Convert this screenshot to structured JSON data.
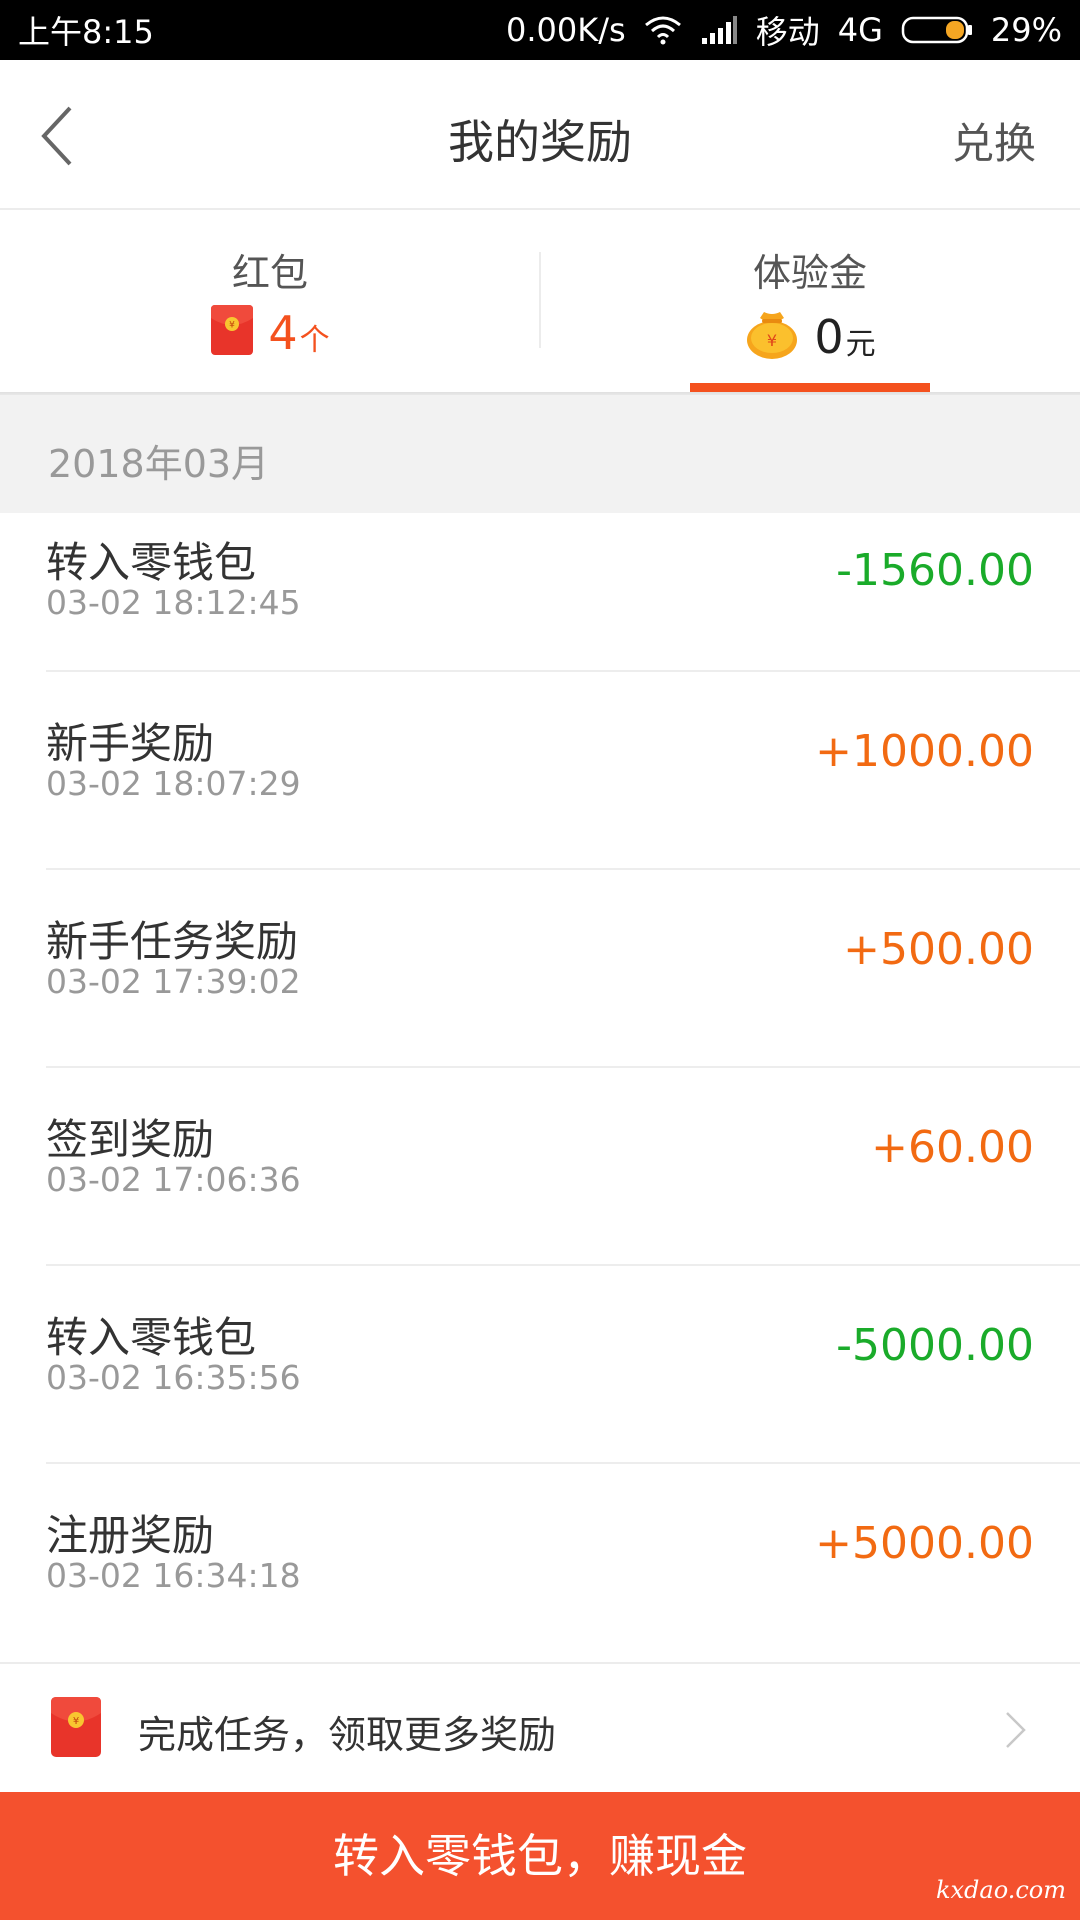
{
  "status_bar": {
    "time": "上午8:15",
    "speed": "0.00K/s",
    "carrier": "移动",
    "network": "4G",
    "battery": "29%"
  },
  "nav": {
    "title": "我的奖励",
    "action": "兑换",
    "back_icon": "chevron-left-icon"
  },
  "tabs": [
    {
      "label": "红包",
      "value": "4",
      "unit": "个",
      "icon": "red-packet-icon",
      "selected": false
    },
    {
      "label": "体验金",
      "value": "0",
      "unit": "元",
      "icon": "money-bag-icon",
      "selected": true
    }
  ],
  "month": "2018年03月",
  "records": [
    {
      "title": "转入零钱包",
      "time": "03-02 18:12:45",
      "amount": "-1560.00",
      "type": "out"
    },
    {
      "title": "新手奖励",
      "time": "03-02 18:07:29",
      "amount": "+1000.00",
      "type": "in"
    },
    {
      "title": "新手任务奖励",
      "time": "03-02 17:39:02",
      "amount": "+500.00",
      "type": "in"
    },
    {
      "title": "签到奖励",
      "time": "03-02 17:06:36",
      "amount": "+60.00",
      "type": "in"
    },
    {
      "title": "转入零钱包",
      "time": "03-02 16:35:56",
      "amount": "-5000.00",
      "type": "out"
    },
    {
      "title": "注册奖励",
      "time": "03-02 16:34:18",
      "amount": "+5000.00",
      "type": "in"
    }
  ],
  "colors": {
    "accent": "#f4511e",
    "positive": "#f26a12",
    "negative": "#1aab2a"
  },
  "task_banner": {
    "text": "完成任务，领取更多奖励"
  },
  "bottom_button": {
    "label": "转入零钱包，赚现金"
  },
  "watermark": "kxdao.com"
}
